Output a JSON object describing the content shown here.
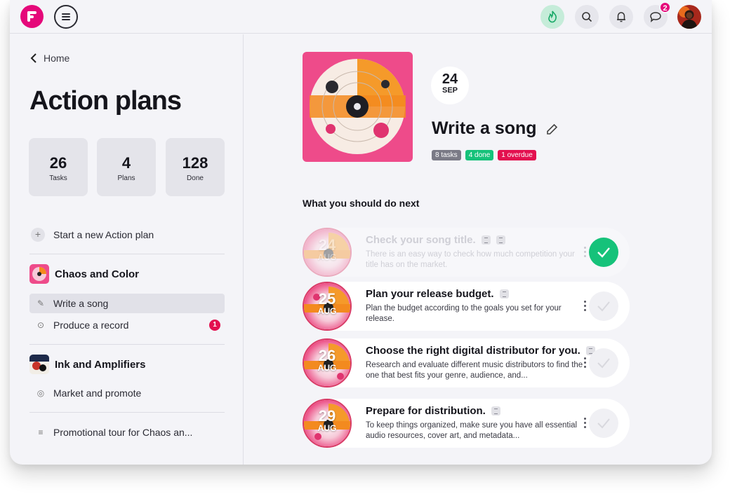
{
  "topbar": {
    "notifications_badge": "2",
    "icons": [
      "logo-icon",
      "menu-icon",
      "fire-icon",
      "search-icon",
      "bell-icon",
      "chat-icon"
    ]
  },
  "sidebar": {
    "back_label": "Home",
    "title": "Action plans",
    "stats": [
      {
        "value": "26",
        "label": "Tasks"
      },
      {
        "value": "4",
        "label": "Plans"
      },
      {
        "value": "128",
        "label": "Done"
      }
    ],
    "new_plan_label": "Start a new Action plan",
    "groups": [
      {
        "name": "Chaos and Color",
        "items": [
          {
            "label": "Write a song",
            "active": true
          },
          {
            "label": "Produce a record",
            "count": "1"
          }
        ]
      },
      {
        "name": "Ink and Amplifiers",
        "items": [
          {
            "label": "Market and promote"
          }
        ]
      }
    ],
    "extra_item": "Promotional tour for Chaos an..."
  },
  "plan": {
    "day": "24",
    "month": "SEP",
    "title": "Write a song",
    "tags": [
      {
        "label": "8 tasks",
        "color": "#7a7a86"
      },
      {
        "label": "4 done",
        "color": "#16c27a"
      },
      {
        "label": "1 overdue",
        "color": "#e3104f"
      }
    ]
  },
  "next_section": "What you should do next",
  "tasks": [
    {
      "day": "24",
      "month": "AUG",
      "title": "Check your song title.",
      "desc": "There is an easy way to check  how much competition your title has on the market.",
      "done": true
    },
    {
      "day": "25",
      "month": "AUG",
      "title": "Plan your release budget.",
      "desc": "Plan the budget according to the goals you set for your release.",
      "done": false
    },
    {
      "day": "26",
      "month": "AUG",
      "title": "Choose the right digital distributor for you.",
      "desc": "Research and evaluate different music distributors to find the one that best fits your genre, audience, and...",
      "done": false
    },
    {
      "day": "29",
      "month": "AUG",
      "title": "Prepare for distribution.",
      "desc": "To keep things organized, make sure you have all essential audio resources, cover art, and metadata...",
      "done": false
    }
  ],
  "colors": {
    "accent": "#e5087a",
    "success": "#16c27a",
    "danger": "#e3104f"
  }
}
